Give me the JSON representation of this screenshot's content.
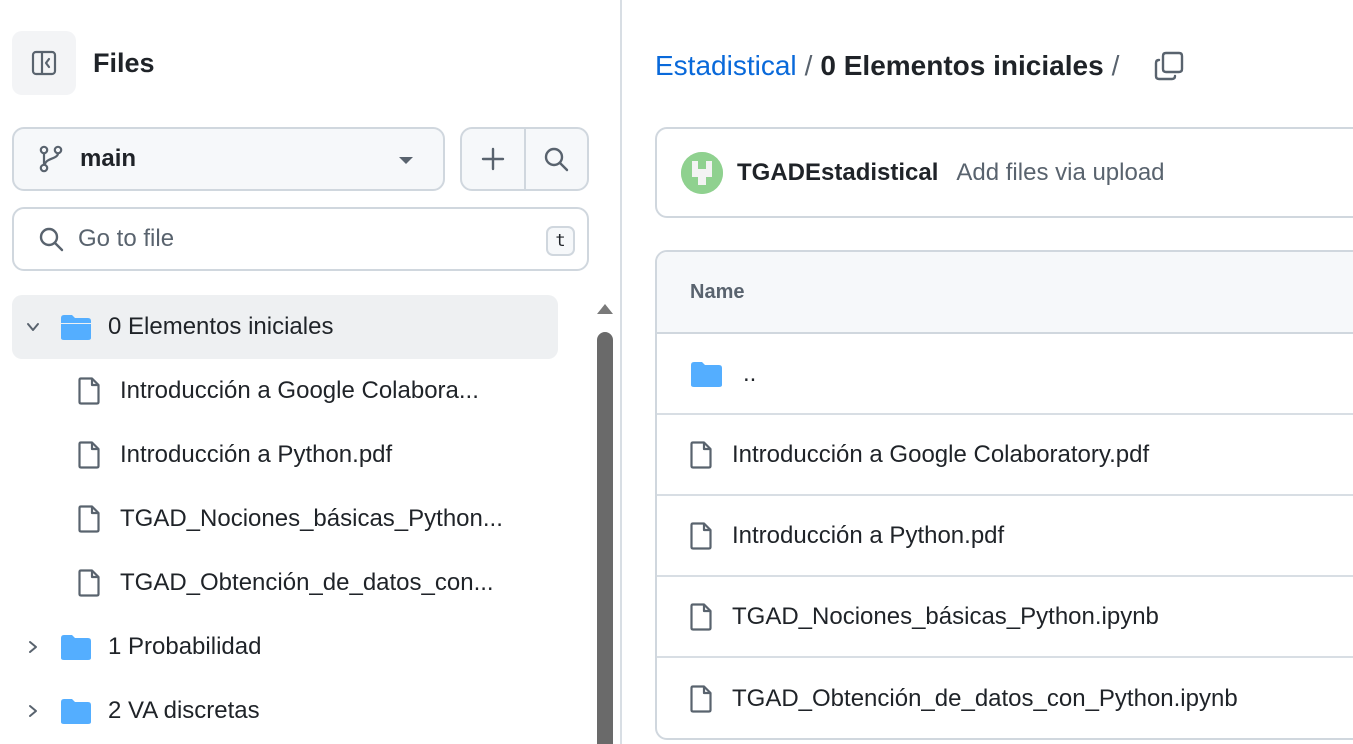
{
  "sidebar": {
    "title": "Files",
    "branch": "main",
    "search_placeholder": "Go to file",
    "shortcut_key": "t",
    "tree": [
      {
        "type": "folder",
        "label": "0 Elementos iniciales",
        "expanded": true,
        "selected": true
      },
      {
        "type": "file",
        "label": "Introducción a Google Colabora..."
      },
      {
        "type": "file",
        "label": "Introducción a Python.pdf"
      },
      {
        "type": "file",
        "label": "TGAD_Nociones_básicas_Python..."
      },
      {
        "type": "file",
        "label": "TGAD_Obtención_de_datos_con..."
      },
      {
        "type": "folder",
        "label": "1 Probabilidad",
        "expanded": false
      },
      {
        "type": "folder",
        "label": "2 VA discretas",
        "expanded": false
      }
    ]
  },
  "breadcrumb": {
    "repo": "Estadistical",
    "separator": "/",
    "current": "0 Elementos iniciales",
    "trailing_separator": "/"
  },
  "commit": {
    "author": "TGADEstadistical",
    "message": "Add files via upload"
  },
  "file_table": {
    "header_name": "Name",
    "rows": [
      {
        "type": "folder",
        "label": ".."
      },
      {
        "type": "file",
        "label": "Introducción a Google Colaboratory.pdf"
      },
      {
        "type": "file",
        "label": "Introducción a Python.pdf"
      },
      {
        "type": "file",
        "label": "TGAD_Nociones_básicas_Python.ipynb"
      },
      {
        "type": "file",
        "label": "TGAD_Obtención_de_datos_con_Python.ipynb"
      }
    ]
  },
  "colors": {
    "link": "#0969da",
    "folder": "#54aeff",
    "border": "#d0d7de",
    "muted_text": "#59636e",
    "selected_row_bg": "#eef0f2"
  },
  "icons": {
    "sidebar_toggle": "sidebar-collapse-icon",
    "branch": "git-branch-icon",
    "add": "plus-icon",
    "search": "search-icon",
    "folder": "folder-icon",
    "file": "file-icon",
    "copy": "copy-icon"
  }
}
